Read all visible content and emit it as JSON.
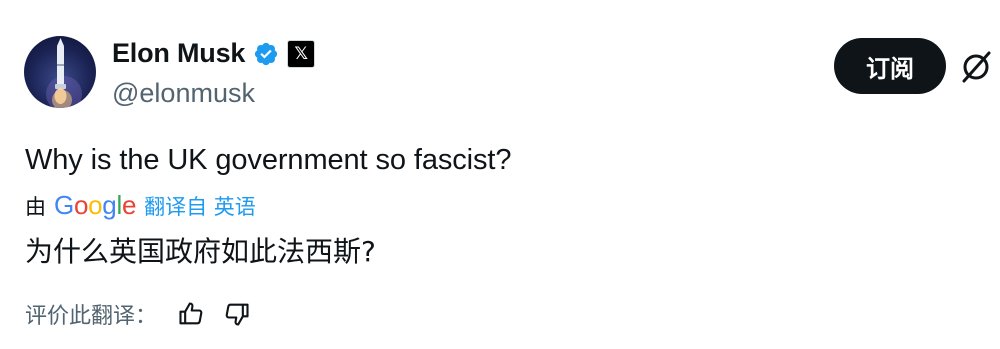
{
  "author": {
    "name": "Elon Musk",
    "handle": "@elonmusk",
    "affiliate_badge": "𝕏",
    "icons": [
      "verified-badge-icon",
      "x-logo-icon"
    ]
  },
  "actions": {
    "subscribe_label": "订阅",
    "grok_icon": "grok-icon"
  },
  "tweet": {
    "text": "Why is the UK government so fascist?"
  },
  "translation": {
    "by_label": "由",
    "google_letters": [
      "G",
      "o",
      "o",
      "g",
      "l",
      "e"
    ],
    "google_colors": [
      "#4285f4",
      "#ea4335",
      "#fbbc05",
      "#4285f4",
      "#34a853",
      "#ea4335"
    ],
    "translated_from_label": "翻译自 英语",
    "translated_text": "为什么英国政府如此法西斯?",
    "rate_label": "评价此翻译：",
    "rate_icons": [
      "thumbs-up-icon",
      "thumbs-down-icon"
    ]
  },
  "colors": {
    "link_blue": "#1d9bf0",
    "secondary_text": "#536471",
    "button_dark": "#0f1419"
  }
}
